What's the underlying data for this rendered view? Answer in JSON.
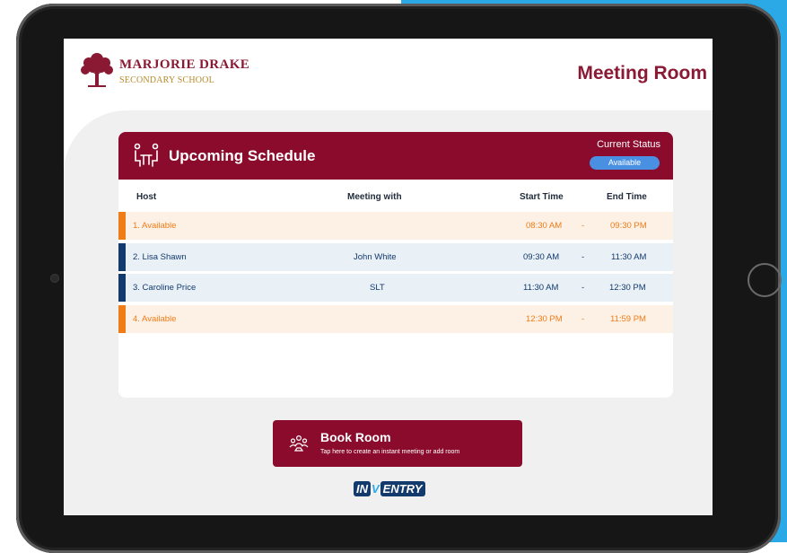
{
  "school": {
    "name": "MARJORIE DRAKE",
    "subtitle": "SECONDARY SCHOOL"
  },
  "room_title": "Meeting Room",
  "schedule": {
    "title": "Upcoming Schedule",
    "status_label": "Current Status",
    "status_value": "Available",
    "columns": {
      "host": "Host",
      "meeting_with": "Meeting with",
      "start": "Start Time",
      "end": "End Time"
    },
    "rows": [
      {
        "host": "1.   Available",
        "meeting_with": "",
        "start": "08:30 AM",
        "sep": "-",
        "end": "09:30 PM",
        "kind": "available"
      },
      {
        "host": "2.   Lisa Shawn",
        "meeting_with": "John White",
        "start": "09:30 AM",
        "sep": "-",
        "end": "11:30 AM",
        "kind": "booked"
      },
      {
        "host": "3.   Caroline Price",
        "meeting_with": "SLT",
        "start": "11:30 AM",
        "sep": "-",
        "end": "12:30 PM",
        "kind": "booked"
      },
      {
        "host": "4.   Available",
        "meeting_with": "",
        "start": "12:30 PM",
        "sep": "-",
        "end": "11:59 PM",
        "kind": "available"
      }
    ]
  },
  "book_button": {
    "title": "Book Room",
    "subtitle": "Tap here to create an instant meeting or add room"
  },
  "brand": {
    "part1": "IN",
    "part2": "V",
    "part3": "ENTRY"
  },
  "colors": {
    "primary": "#8a0b2c",
    "available": "#f07c17",
    "booked": "#123a6d",
    "status": "#4a90e2"
  },
  "icons": {
    "logo": "tree-logo-icon",
    "schedule": "meeting-people-icon",
    "book": "group-people-icon"
  }
}
